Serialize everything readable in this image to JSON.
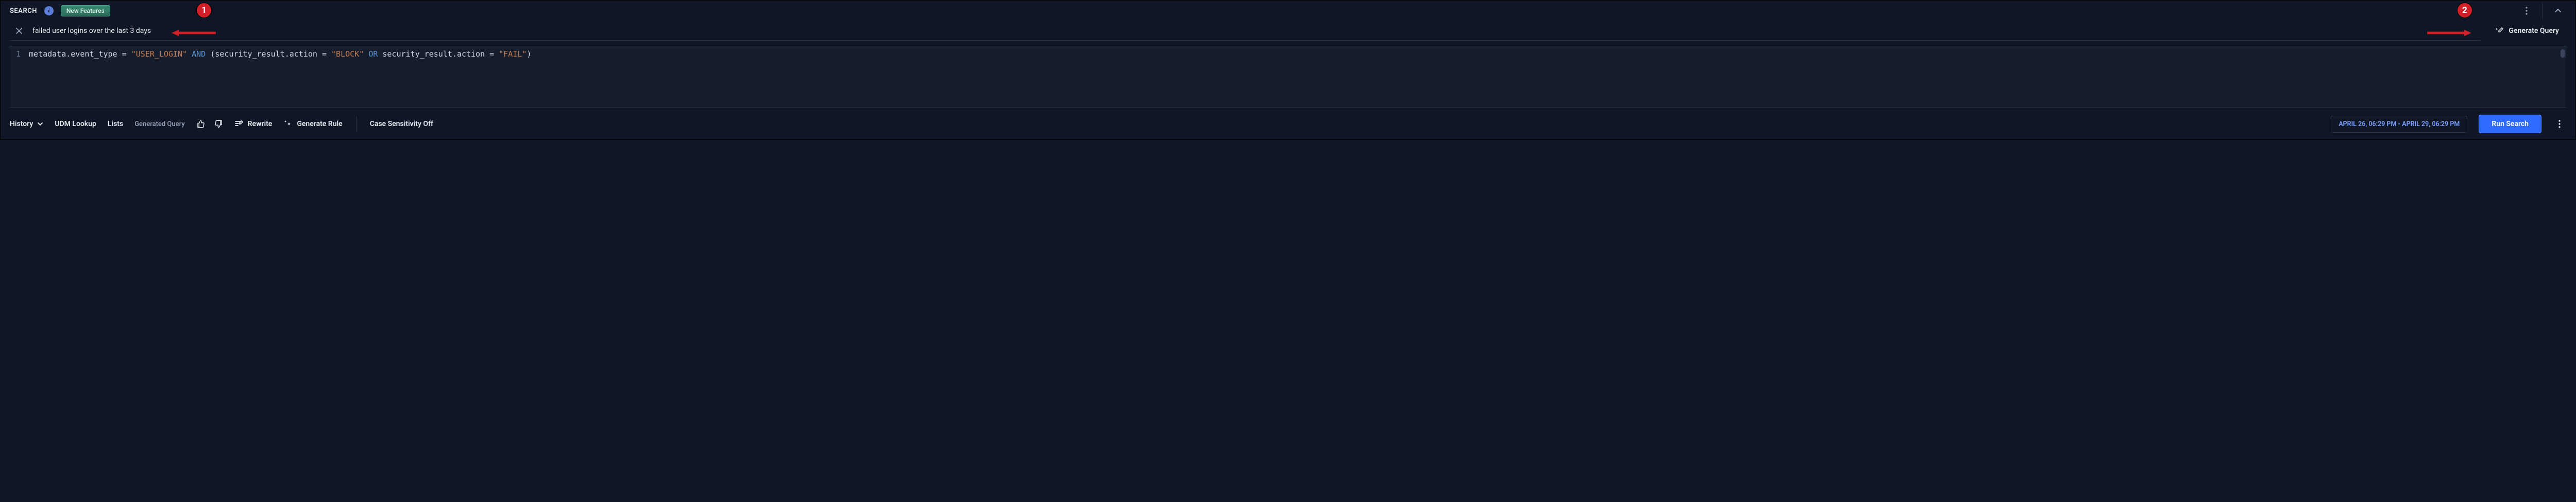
{
  "topbar": {
    "title": "SEARCH",
    "new_features_label": "New Features"
  },
  "nl_input": {
    "text": "failed user logins over the last 3 days",
    "generate_btn": "Generate Query"
  },
  "editor": {
    "line_no": "1",
    "tokens": {
      "f1": "metadata.event_type",
      "eq": " = ",
      "s1": "\"USER_LOGIN\"",
      "and": " AND ",
      "lp": "(",
      "f2": "security_result.action",
      "s2": "\"BLOCK\"",
      "or": " OR ",
      "f3": "security_result.action",
      "s3": "\"FAIL\"",
      "rp": ")"
    }
  },
  "bottombar": {
    "history": "History",
    "udm_lookup": "UDM Lookup",
    "lists": "Lists",
    "generated_query": "Generated Query",
    "rewrite": "Rewrite",
    "generate_rule": "Generate Rule",
    "case_sensitivity": "Case Sensitivity Off",
    "time_range": "APRIL 26, 06:29 PM - APRIL 29, 06:29 PM",
    "run_search": "Run Search"
  },
  "callouts": {
    "one": "1",
    "two": "2"
  }
}
